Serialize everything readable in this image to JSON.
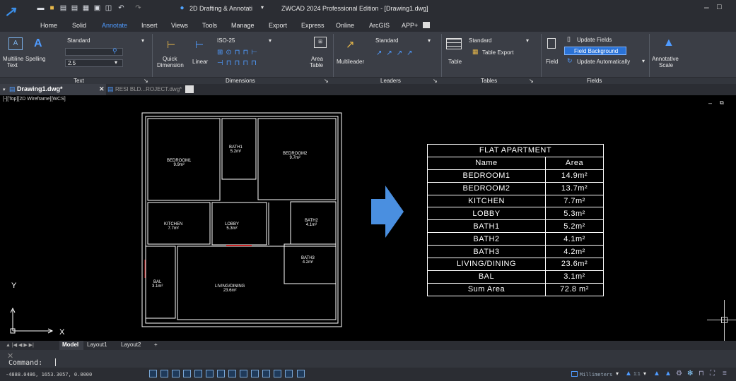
{
  "titlebar": {
    "workspace": "2D Drafting & Annotati",
    "title": "ZWCAD 2024 Professional Edition - [Drawing1.dwg]"
  },
  "tabs": [
    "Home",
    "Solid",
    "Annotate",
    "Insert",
    "Views",
    "Tools",
    "Manage",
    "Export",
    "Express",
    "Online",
    "ArcGIS",
    "APP+"
  ],
  "ribbon": {
    "text": {
      "multiline": "Multiline",
      "multiline2": "Text",
      "spelling": "Spelling",
      "style": "Standard",
      "height": "2.5",
      "group": "Text"
    },
    "dimensions": {
      "quick": "Quick",
      "quick2": "Dimension",
      "linear": "Linear",
      "style": "ISO-25",
      "area": "Area",
      "area2": "Table",
      "group": "Dimensions"
    },
    "leaders": {
      "multileader": "Multileader",
      "style": "Standard",
      "group": "Leaders"
    },
    "tables": {
      "table": "Table",
      "style": "Standard",
      "export": "Table Export",
      "group": "Tables"
    },
    "fields": {
      "field": "Field",
      "update": "Update Fields",
      "background": "Field Background",
      "auto": "Update Automatically",
      "group": "Fields"
    },
    "scale": {
      "label": "Annotative",
      "label2": "Scale"
    }
  },
  "doctabs": {
    "active": "Drawing1.dwg*",
    "other": "RESI BLD...ROJECT.dwg*"
  },
  "viewport": {
    "label": "[-][Top][2D Wireframe][WCS]"
  },
  "rooms": [
    {
      "name": "BATH1",
      "area": "5.2m²"
    },
    {
      "name": "BEDROOM1",
      "area": "9.9m²"
    },
    {
      "name": "BEDROOM2",
      "area": "9.7m²"
    },
    {
      "name": "KITCHEN",
      "area": "7.7m²"
    },
    {
      "name": "LOBBY",
      "area": "5.3m²"
    },
    {
      "name": "BATH2",
      "area": "4.1m²"
    },
    {
      "name": "BATH3",
      "area": "4.2m²"
    },
    {
      "name": "BAL",
      "area": "3.1m²"
    },
    {
      "name": "LIVING/DINING",
      "area": "23.6m²"
    }
  ],
  "table": {
    "title": "FLAT APARTMENT",
    "headers": [
      "Name",
      "Area"
    ],
    "rows": [
      [
        "BEDROOM1",
        "14.9m²"
      ],
      [
        "BEDROOM2",
        "13.7m²"
      ],
      [
        "KITCHEN",
        "7.7m²"
      ],
      [
        "LOBBY",
        "5.3m²"
      ],
      [
        "BATH1",
        "5.2m²"
      ],
      [
        "BATH2",
        "4.1m²"
      ],
      [
        "BATH3",
        "4.2m²"
      ],
      [
        "LIVING/DINING",
        "23.6m²"
      ],
      [
        "BAL",
        "3.1m²"
      ]
    ],
    "sum": [
      "Sum Area",
      "72.8 m²"
    ]
  },
  "ucs": {
    "x": "X",
    "y": "Y"
  },
  "layouts": [
    "Model",
    "Layout1",
    "Layout2",
    "+"
  ],
  "command": {
    "label": "Command:"
  },
  "status": {
    "coords": "-4888.0486, 1653.3057, 0.0000",
    "units": "Millimeters",
    "scale": "1:1"
  },
  "colors": {
    "accent": "#4f9bff",
    "arrow": "#4a8fe0",
    "door": "#cc2222"
  }
}
